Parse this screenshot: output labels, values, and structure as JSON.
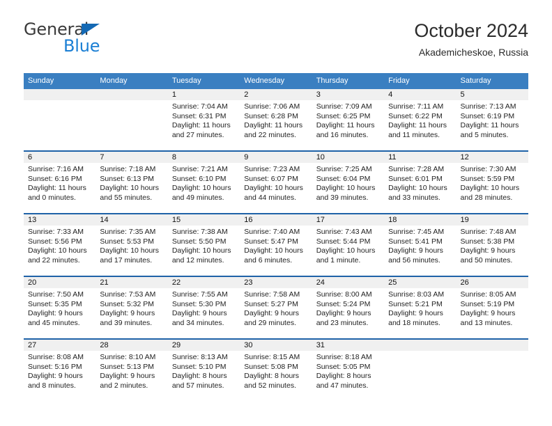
{
  "brand": {
    "name_top": "General",
    "name_bottom": "Blue",
    "accent_color": "#1b7fd4",
    "triangle_color": "#1469b4"
  },
  "header": {
    "title": "October 2024",
    "subtitle": "Akademicheskoe, Russia"
  },
  "theme": {
    "header_row_bg": "#3a7fc1",
    "row_divider": "#1f62a8",
    "daynum_band_bg": "#f0f0f0"
  },
  "weekday_headers": [
    "Sunday",
    "Monday",
    "Tuesday",
    "Wednesday",
    "Thursday",
    "Friday",
    "Saturday"
  ],
  "weeks": [
    [
      {
        "empty": true
      },
      {
        "empty": true
      },
      {
        "day": "1",
        "sunrise": "Sunrise: 7:04 AM",
        "sunset": "Sunset: 6:31 PM",
        "daylight": "Daylight: 11 hours and 27 minutes."
      },
      {
        "day": "2",
        "sunrise": "Sunrise: 7:06 AM",
        "sunset": "Sunset: 6:28 PM",
        "daylight": "Daylight: 11 hours and 22 minutes."
      },
      {
        "day": "3",
        "sunrise": "Sunrise: 7:09 AM",
        "sunset": "Sunset: 6:25 PM",
        "daylight": "Daylight: 11 hours and 16 minutes."
      },
      {
        "day": "4",
        "sunrise": "Sunrise: 7:11 AM",
        "sunset": "Sunset: 6:22 PM",
        "daylight": "Daylight: 11 hours and 11 minutes."
      },
      {
        "day": "5",
        "sunrise": "Sunrise: 7:13 AM",
        "sunset": "Sunset: 6:19 PM",
        "daylight": "Daylight: 11 hours and 5 minutes."
      }
    ],
    [
      {
        "day": "6",
        "sunrise": "Sunrise: 7:16 AM",
        "sunset": "Sunset: 6:16 PM",
        "daylight": "Daylight: 11 hours and 0 minutes."
      },
      {
        "day": "7",
        "sunrise": "Sunrise: 7:18 AM",
        "sunset": "Sunset: 6:13 PM",
        "daylight": "Daylight: 10 hours and 55 minutes."
      },
      {
        "day": "8",
        "sunrise": "Sunrise: 7:21 AM",
        "sunset": "Sunset: 6:10 PM",
        "daylight": "Daylight: 10 hours and 49 minutes."
      },
      {
        "day": "9",
        "sunrise": "Sunrise: 7:23 AM",
        "sunset": "Sunset: 6:07 PM",
        "daylight": "Daylight: 10 hours and 44 minutes."
      },
      {
        "day": "10",
        "sunrise": "Sunrise: 7:25 AM",
        "sunset": "Sunset: 6:04 PM",
        "daylight": "Daylight: 10 hours and 39 minutes."
      },
      {
        "day": "11",
        "sunrise": "Sunrise: 7:28 AM",
        "sunset": "Sunset: 6:01 PM",
        "daylight": "Daylight: 10 hours and 33 minutes."
      },
      {
        "day": "12",
        "sunrise": "Sunrise: 7:30 AM",
        "sunset": "Sunset: 5:59 PM",
        "daylight": "Daylight: 10 hours and 28 minutes."
      }
    ],
    [
      {
        "day": "13",
        "sunrise": "Sunrise: 7:33 AM",
        "sunset": "Sunset: 5:56 PM",
        "daylight": "Daylight: 10 hours and 22 minutes."
      },
      {
        "day": "14",
        "sunrise": "Sunrise: 7:35 AM",
        "sunset": "Sunset: 5:53 PM",
        "daylight": "Daylight: 10 hours and 17 minutes."
      },
      {
        "day": "15",
        "sunrise": "Sunrise: 7:38 AM",
        "sunset": "Sunset: 5:50 PM",
        "daylight": "Daylight: 10 hours and 12 minutes."
      },
      {
        "day": "16",
        "sunrise": "Sunrise: 7:40 AM",
        "sunset": "Sunset: 5:47 PM",
        "daylight": "Daylight: 10 hours and 6 minutes."
      },
      {
        "day": "17",
        "sunrise": "Sunrise: 7:43 AM",
        "sunset": "Sunset: 5:44 PM",
        "daylight": "Daylight: 10 hours and 1 minute."
      },
      {
        "day": "18",
        "sunrise": "Sunrise: 7:45 AM",
        "sunset": "Sunset: 5:41 PM",
        "daylight": "Daylight: 9 hours and 56 minutes."
      },
      {
        "day": "19",
        "sunrise": "Sunrise: 7:48 AM",
        "sunset": "Sunset: 5:38 PM",
        "daylight": "Daylight: 9 hours and 50 minutes."
      }
    ],
    [
      {
        "day": "20",
        "sunrise": "Sunrise: 7:50 AM",
        "sunset": "Sunset: 5:35 PM",
        "daylight": "Daylight: 9 hours and 45 minutes."
      },
      {
        "day": "21",
        "sunrise": "Sunrise: 7:53 AM",
        "sunset": "Sunset: 5:32 PM",
        "daylight": "Daylight: 9 hours and 39 minutes."
      },
      {
        "day": "22",
        "sunrise": "Sunrise: 7:55 AM",
        "sunset": "Sunset: 5:30 PM",
        "daylight": "Daylight: 9 hours and 34 minutes."
      },
      {
        "day": "23",
        "sunrise": "Sunrise: 7:58 AM",
        "sunset": "Sunset: 5:27 PM",
        "daylight": "Daylight: 9 hours and 29 minutes."
      },
      {
        "day": "24",
        "sunrise": "Sunrise: 8:00 AM",
        "sunset": "Sunset: 5:24 PM",
        "daylight": "Daylight: 9 hours and 23 minutes."
      },
      {
        "day": "25",
        "sunrise": "Sunrise: 8:03 AM",
        "sunset": "Sunset: 5:21 PM",
        "daylight": "Daylight: 9 hours and 18 minutes."
      },
      {
        "day": "26",
        "sunrise": "Sunrise: 8:05 AM",
        "sunset": "Sunset: 5:19 PM",
        "daylight": "Daylight: 9 hours and 13 minutes."
      }
    ],
    [
      {
        "day": "27",
        "sunrise": "Sunrise: 8:08 AM",
        "sunset": "Sunset: 5:16 PM",
        "daylight": "Daylight: 9 hours and 8 minutes."
      },
      {
        "day": "28",
        "sunrise": "Sunrise: 8:10 AM",
        "sunset": "Sunset: 5:13 PM",
        "daylight": "Daylight: 9 hours and 2 minutes."
      },
      {
        "day": "29",
        "sunrise": "Sunrise: 8:13 AM",
        "sunset": "Sunset: 5:10 PM",
        "daylight": "Daylight: 8 hours and 57 minutes."
      },
      {
        "day": "30",
        "sunrise": "Sunrise: 8:15 AM",
        "sunset": "Sunset: 5:08 PM",
        "daylight": "Daylight: 8 hours and 52 minutes."
      },
      {
        "day": "31",
        "sunrise": "Sunrise: 8:18 AM",
        "sunset": "Sunset: 5:05 PM",
        "daylight": "Daylight: 8 hours and 47 minutes."
      },
      {
        "empty": true
      },
      {
        "empty": true
      }
    ]
  ]
}
